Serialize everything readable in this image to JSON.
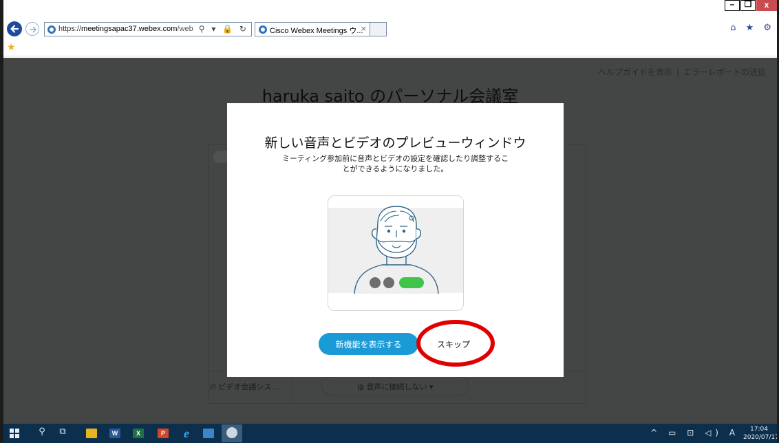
{
  "browser": {
    "window_controls": {
      "minimize": "–",
      "restore": "❐",
      "close": "x"
    },
    "address": {
      "scheme": "https://",
      "host": "meetingsapac37.webex.com",
      "path": "/webappn",
      "icons": "⚲ ▾ 🔒 ↻"
    },
    "tab": {
      "title": "Cisco Webex Meetings ウ...",
      "close": "×"
    },
    "right_icons": "⌂ ★ ⚙"
  },
  "page": {
    "help_link": "ヘルプガイドを表示",
    "separator": "|",
    "error_report_link": "エラーレポートの送信",
    "meeting_title": "haruka saito のパーソナル会議室",
    "video_system_label": "ビデオ会議シス…",
    "audio_button_label": "音声に接続しない ▾"
  },
  "modal": {
    "title": "新しい音声とビデオのプレビューウィンドウ",
    "description_line1": "ミーティング参加前に音声とビデオの設定を確認したり調整するこ",
    "description_line2": "とができるようになりました。",
    "primary_button": "新機能を表示する",
    "skip_button": "スキップ"
  },
  "taskbar": {
    "clock_time": "17:04",
    "clock_date": "2020/07/17",
    "tray_icons": "^ ▭ ⊡ ◁) A",
    "word_label": "W",
    "excel_label": "X",
    "ppt_label": "P"
  },
  "colors": {
    "accent_blue": "#1a9bd7",
    "overlay": "#444545",
    "highlight_red": "#e00000",
    "taskbar": "#0d2f4e"
  }
}
